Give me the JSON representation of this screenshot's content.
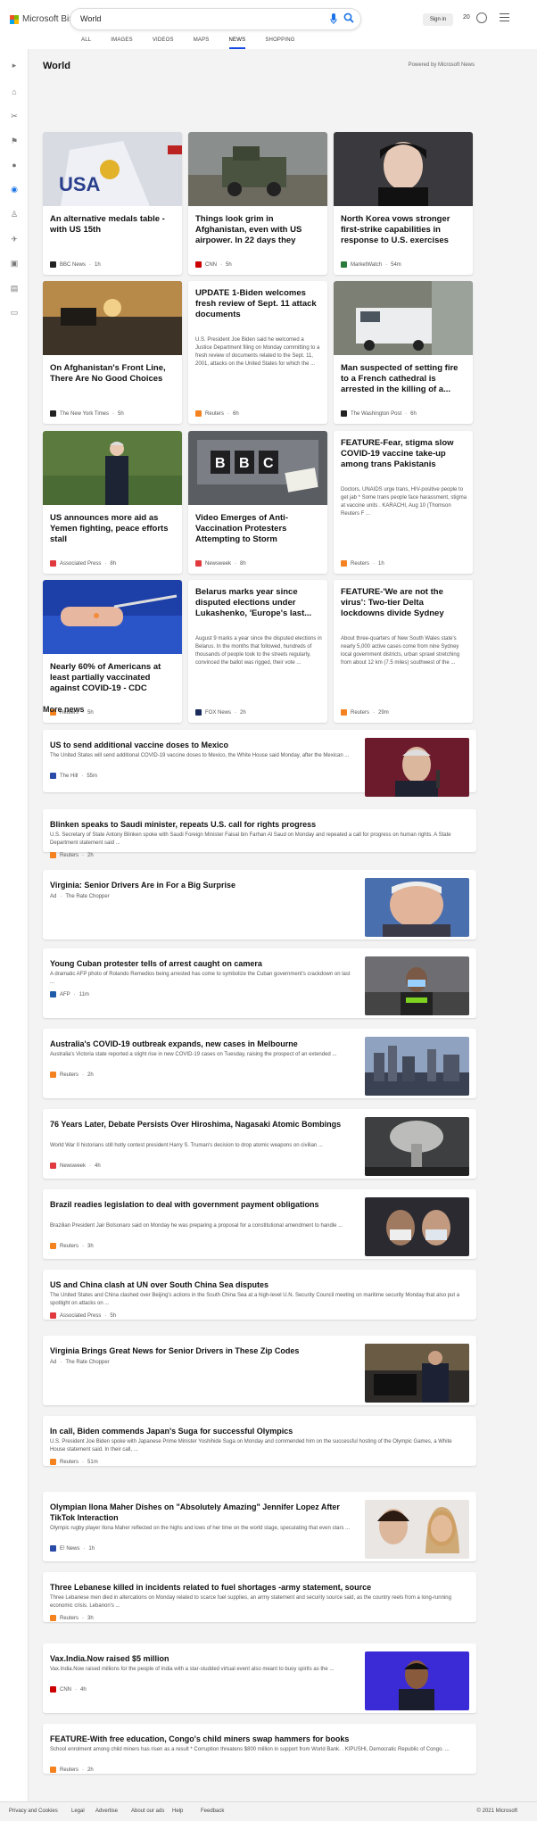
{
  "header": {
    "logo": "Microsoft Bing",
    "query": "World",
    "signin": "Sign in",
    "rewards": "20"
  },
  "tabs": [
    "ALL",
    "IMAGES",
    "VIDEOS",
    "MAPS",
    "NEWS",
    "SHOPPING"
  ],
  "section": {
    "title": "World",
    "powered": "Powered by Microsoft News"
  },
  "cards": [
    {
      "title": "An alternative medals table - with US 15th",
      "source": "BBC News",
      "time": "1h",
      "logo_color": "#222",
      "img": "medal"
    },
    {
      "title": "Things look grim in Afghanistan, even with US airpower. In 22 days they coul...",
      "source": "CNN",
      "time": "5h",
      "logo_color": "#cc0000",
      "img": "army"
    },
    {
      "title": "North Korea vows stronger first-strike capabilities in response to U.S. exercises wit...",
      "source": "MarketWatch",
      "time": "54m",
      "logo_color": "#2a7a3b",
      "img": "woman"
    },
    {
      "title": "On Afghanistan's Front Line, There Are No Good Choices",
      "source": "The New York Times",
      "time": "5h",
      "logo_color": "#222",
      "img": "sunset"
    },
    {
      "title": "UPDATE 1-Biden welcomes fresh review of Sept. 11 attack documents",
      "desc": "U.S. President Joe Biden said he welcomed a Justice Department filing on Monday committing to a fresh review of documents related to the Sept. 11, 2001, attacks on the United States for which the ...",
      "source": "Reuters",
      "time": "6h",
      "logo_color": "#f58220"
    },
    {
      "title": "Man suspected of setting fire to a French cathedral is arrested in the killing of a...",
      "source": "The Washington Post",
      "time": "6h",
      "logo_color": "#222",
      "img": "van"
    },
    {
      "title": "US announces more aid as Yemen fighting, peace efforts stall",
      "source": "Associated Press",
      "time": "8h",
      "logo_color": "#e03a3e",
      "img": "biden"
    },
    {
      "title": "Video Emerges of Anti-Vaccination Protesters Attempting to Storm Televisio...",
      "source": "Newsweek",
      "time": "8h",
      "logo_color": "#e03a3e",
      "img": "bbc"
    },
    {
      "title": "FEATURE-Fear, stigma slow COVID-19 vaccine take-up among trans Pakistanis",
      "desc": "Doctors, UNAIDS urge trans, HIV-positive people to get jab * Some trans people face harassment, stigma at vaccine units . KARACHI, Aug 10 (Thomson Reuters F ...",
      "source": "Reuters",
      "time": "1h",
      "logo_color": "#f58220"
    },
    {
      "title": "Nearly 60% of Americans at least partially vaccinated against COVID-19 - CDC",
      "source": "Reuters",
      "time": "5h",
      "logo_color": "#f58220",
      "img": "vaccine"
    },
    {
      "title": "Belarus marks year since disputed elections under Lukashenko, 'Europe's last...",
      "desc": "August 9 marks a year since the disputed elections in Belarus. In the months that followed, hundreds of thousands of people took to the streets regularly, convinced the ballot was rigged, their vote ...",
      "source": "FOX News",
      "time": "2h",
      "logo_color": "#1a2b5c"
    },
    {
      "title": "FEATURE-'We are not the virus': Two-tier Delta lockdowns divide Sydney",
      "desc": "About three-quarters of New South Wales state's nearly 5,000 active cases come from nine Sydney local government districts, urban sprawl stretching from about 12 km (7.5 miles) southwest of the ...",
      "source": "Reuters",
      "time": "29m",
      "logo_color": "#f58220"
    }
  ],
  "more": {
    "title": "More news",
    "rows": [
      {
        "title": "US to send additional vaccine doses to Mexico",
        "desc": "The United States will send additional COVID-19 vaccine doses to Mexico, the White House said Monday, after the Mexican ...",
        "source": "The Hill",
        "time": "55m",
        "logo_color": "#2a4aa8",
        "img": "amlo"
      },
      {
        "title": "Blinken speaks to Saudi minister, repeats U.S. call for rights progress",
        "desc": "U.S. Secretary of State Antony Blinken spoke with Saudi Foreign Minister Faisal bin Farhan Al Saud on Monday and repeated a call for progress on human rights. A State Department statement said ...",
        "source": "Reuters",
        "time": "2h",
        "logo_color": "#f58220"
      },
      {
        "title": "Virginia: Senior Drivers Are in For a Big Surprise",
        "source": "The Rate Chopper",
        "ad": "Ad",
        "img": "oldman"
      },
      {
        "title": "Young Cuban protester tells of arrest caught on camera",
        "desc": "A dramatic AFP photo of Rolando Remedios being arrested has come to symbolize the Cuban government's crackdown on last ...",
        "source": "AFP",
        "time": "11m",
        "logo_color": "#1e5aa8",
        "img": "cuba"
      },
      {
        "title": "Australia's COVID-19 outbreak expands, new cases in Melbourne",
        "desc": "Australia's Victoria state reported a slight rise in new COVID-19 cases on Tuesday, raising the prospect of an extended ...",
        "source": "Reuters",
        "time": "2h",
        "logo_color": "#f58220",
        "img": "city"
      },
      {
        "title": "76 Years Later, Debate Persists Over Hiroshima, Nagasaki Atomic Bombings",
        "desc": "World War II historians still hotly contest president Harry S. Truman's decision to drop atomic weapons on civilian ...",
        "source": "Newsweek",
        "time": "4h",
        "logo_color": "#e03a3e",
        "img": "bomb"
      },
      {
        "title": "Brazil readies legislation to deal with government payment obligations",
        "desc": "Brazilian President Jair Bolsonaro said on Monday he was preparing a proposal for a constitutional amendment to handle ...",
        "source": "Reuters",
        "time": "3h",
        "logo_color": "#f58220",
        "img": "masks"
      },
      {
        "title": "US and China clash at UN over South China Sea disputes",
        "desc": "The United States and China clashed over Beijing's actions in the South China Sea at a high-level U.N. Security Council meeting on maritime security Monday that also put a spotlight on attacks on ...",
        "source": "Associated Press",
        "time": "5h",
        "logo_color": "#e03a3e"
      },
      {
        "title": "Virginia Brings Great News for Senior Drivers in These Zip Codes",
        "source": "The Rate Chopper",
        "ad": "Ad",
        "img": "police"
      },
      {
        "title": "In call, Biden commends Japan's Suga for successful Olympics",
        "desc": "U.S. President Joe Biden spoke with Japanese Prime Minister Yoshihide Suga on Monday and commended him on the successful hosting of the Olympic Games, a White House statement said. In their call, ...",
        "source": "Reuters",
        "time": "51m",
        "logo_color": "#f58220"
      },
      {
        "title": "Olympian Ilona Maher Dishes on \"Absolutely Amazing\" Jennifer Lopez After TikTok Interaction",
        "desc": "Olympic rugby player Ilona Maher reflected on the highs and lows of her time on the world stage, speculating that even stars ...",
        "source": "E! News",
        "time": "1h",
        "logo_color": "#2a4aa8",
        "img": "jlo"
      },
      {
        "title": "Three Lebanese killed in incidents related to fuel shortages -army statement, source",
        "desc": "Three Lebanese men died in altercations on Monday related to scarce fuel supplies, an army statement and security source said, as the country reels from a long-running economic crisis. Lebanon's ...",
        "source": "Reuters",
        "time": "3h",
        "logo_color": "#f58220"
      },
      {
        "title": "Vax.India.Now raised $5 million",
        "desc": "Vax.India.Now raised millions for the people of India with a star-studded virtual event also meant to buoy spirits as the ...",
        "source": "CNN",
        "time": "4h",
        "logo_color": "#cc0000",
        "img": "hasan"
      },
      {
        "title": "FEATURE-With free education, Congo's child miners swap hammers for books",
        "desc": "School enrolment among child miners has risen as a result * Corruption threatens $800 million in support from World Bank. . KIPUSHI, Democratic Republic of Congo. ...",
        "source": "Reuters",
        "time": "2h",
        "logo_color": "#f58220"
      }
    ]
  },
  "footer": {
    "links": [
      "Privacy and Cookies",
      "Legal",
      "Advertise",
      "About our ads",
      "Help",
      "Feedback"
    ],
    "copyright": "© 2021 Microsoft"
  }
}
